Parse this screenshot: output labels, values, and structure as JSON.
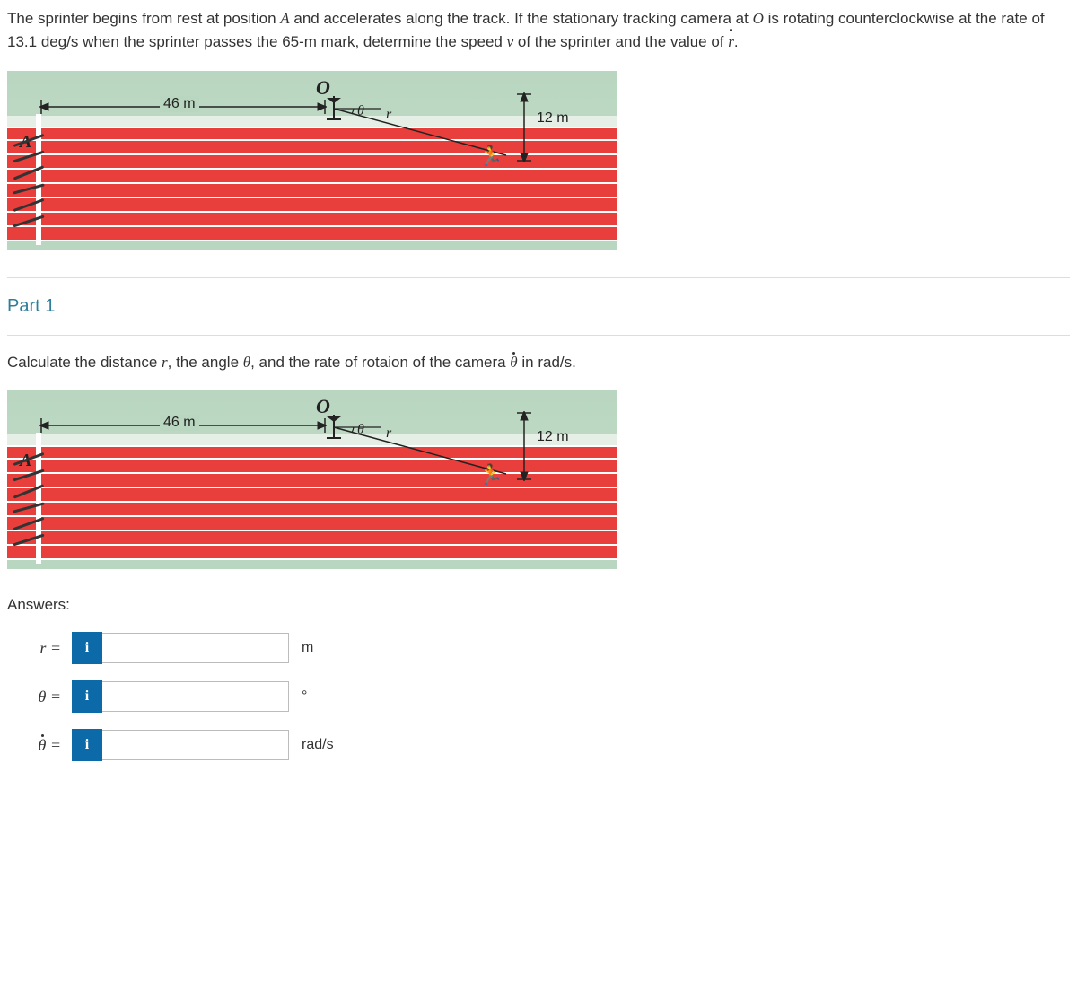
{
  "problem": {
    "text_parts": [
      "The sprinter begins from rest at position ",
      " and accelerates along the track. If the stationary tracking camera at ",
      " is rotating counterclockwise at the rate of ",
      " deg/s when the sprinter passes the ",
      "-m mark, determine the speed ",
      " of the sprinter and the value of "
    ],
    "pos_A": "A",
    "pos_O": "O",
    "rate_deg_s": "13.1",
    "mark_m": "65",
    "var_v": "v",
    "var_rdot": "ṙ",
    "period": "."
  },
  "diagram": {
    "dist_AO": "46 m",
    "offset_perp": "12 m",
    "label_O": "O",
    "label_A": "A",
    "label_theta": "θ",
    "label_r": "r"
  },
  "part1": {
    "heading": "Part 1",
    "instruction_parts": [
      "Calculate the distance ",
      ", the angle ",
      ", and the rate of rotaion of the camera ",
      " in rad/s."
    ],
    "var_r": "r",
    "var_theta": "θ",
    "var_theta_dot": "θ̇"
  },
  "answers": {
    "label": "Answers:",
    "rows": [
      {
        "var": "r =",
        "unit": "m",
        "value": ""
      },
      {
        "var": "θ =",
        "unit": "°",
        "value": ""
      },
      {
        "var": "θ̇ =",
        "unit": "rad/s",
        "value": ""
      }
    ],
    "info_icon": "i"
  }
}
